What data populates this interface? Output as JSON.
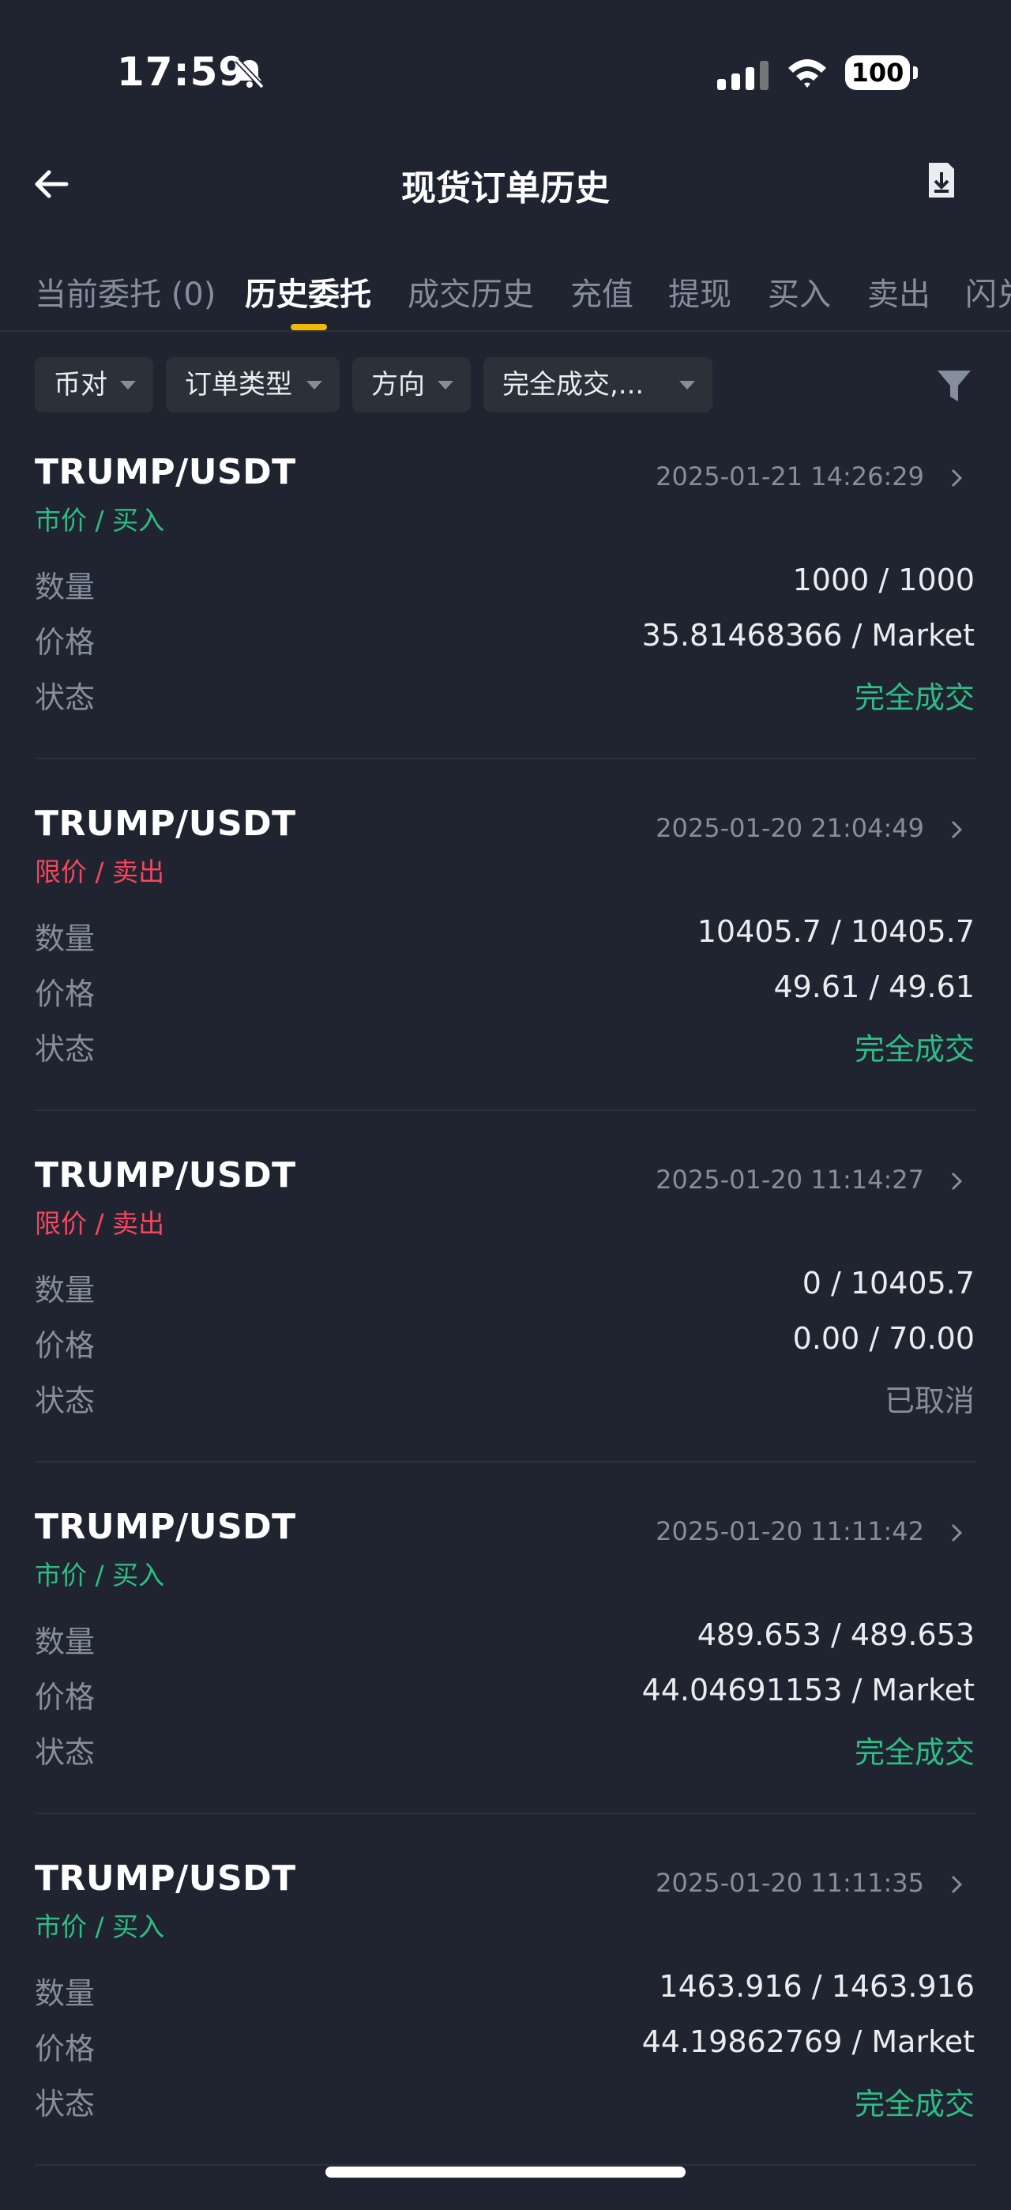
{
  "status_bar": {
    "time": "17:59",
    "battery": "100"
  },
  "header": {
    "title": "现货订单历史"
  },
  "tabs": [
    {
      "label": "当前委托 (0)"
    },
    {
      "label": "历史委托"
    },
    {
      "label": "成交历史"
    },
    {
      "label": "充值"
    },
    {
      "label": "提现"
    },
    {
      "label": "买入"
    },
    {
      "label": "卖出"
    },
    {
      "label": "闪兑"
    }
  ],
  "filters": {
    "pair": "币对",
    "order_type": "订单类型",
    "direction": "方向",
    "status": "完全成交,..."
  },
  "labels": {
    "qty": "数量",
    "price": "价格",
    "status": "状态"
  },
  "orders": [
    {
      "pair": "TRUMP/USDT",
      "type": "市价 / 买入",
      "side": "buy",
      "datetime": "2025-01-21 14:26:29",
      "qty": "1000 / 1000",
      "price": "35.81468366 / Market",
      "status": "完全成交"
    },
    {
      "pair": "TRUMP/USDT",
      "type": "限价 / 卖出",
      "side": "sell",
      "datetime": "2025-01-20 21:04:49",
      "qty": "10405.7 / 10405.7",
      "price": "49.61 / 49.61",
      "status": "完全成交"
    },
    {
      "pair": "TRUMP/USDT",
      "type": "限价 / 卖出",
      "side": "sell",
      "datetime": "2025-01-20 11:14:27",
      "qty": "0 / 10405.7",
      "price": "0.00 / 70.00",
      "status": "已取消"
    },
    {
      "pair": "TRUMP/USDT",
      "type": "市价 / 买入",
      "side": "buy",
      "datetime": "2025-01-20 11:11:42",
      "qty": "489.653 / 489.653",
      "price": "44.04691153 / Market",
      "status": "完全成交"
    },
    {
      "pair": "TRUMP/USDT",
      "type": "市价 / 买入",
      "side": "buy",
      "datetime": "2025-01-20 11:11:35",
      "qty": "1463.916 / 1463.916",
      "price": "44.19862769 / Market",
      "status": "完全成交"
    }
  ],
  "colors": {
    "background": "#1f2430",
    "accent": "#f0b90b",
    "buy": "#2ebd85",
    "sell": "#f6465d",
    "muted": "#848e9c"
  }
}
